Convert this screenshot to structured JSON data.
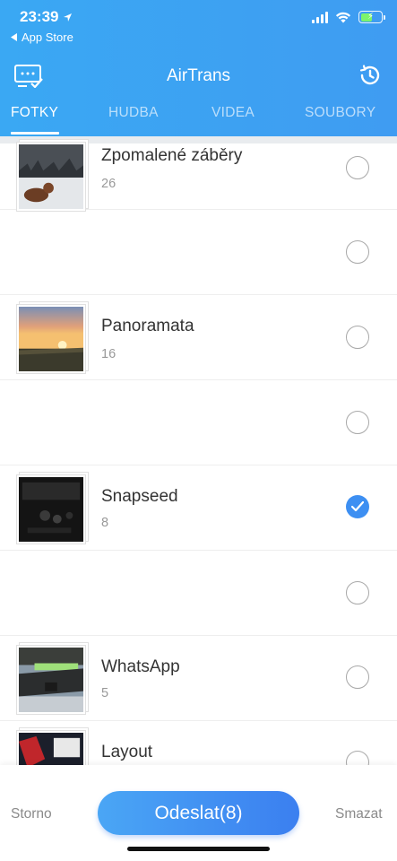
{
  "status": {
    "time": "23:39",
    "back_app": "App Store"
  },
  "appbar": {
    "title": "AirTrans",
    "left_icon": "transfer-list-icon",
    "right_icon": "history-clock-icon"
  },
  "tabs": [
    {
      "label": "FOTKY",
      "active": true
    },
    {
      "label": "HUDBA",
      "active": false
    },
    {
      "label": "VIDEA",
      "active": false
    },
    {
      "label": "SOUBORY",
      "active": false
    }
  ],
  "albums": [
    {
      "name": "Zpomalené záběry",
      "count": "26",
      "checked": false
    },
    {
      "name": "",
      "count": "",
      "checked": false
    },
    {
      "name": "Panoramata",
      "count": "16",
      "checked": false
    },
    {
      "name": "",
      "count": "",
      "checked": false
    },
    {
      "name": "Snapseed",
      "count": "8",
      "checked": true
    },
    {
      "name": "",
      "count": "",
      "checked": false
    },
    {
      "name": "WhatsApp",
      "count": "5",
      "checked": false
    },
    {
      "name": "Layout",
      "count": "",
      "checked": false
    }
  ],
  "bottom": {
    "cancel_label": "Storno",
    "send_label": "Odeslat(8)",
    "delete_label": "Smazat"
  },
  "colors": {
    "header": "#3aa8f3",
    "accent": "#3d8ff2"
  }
}
